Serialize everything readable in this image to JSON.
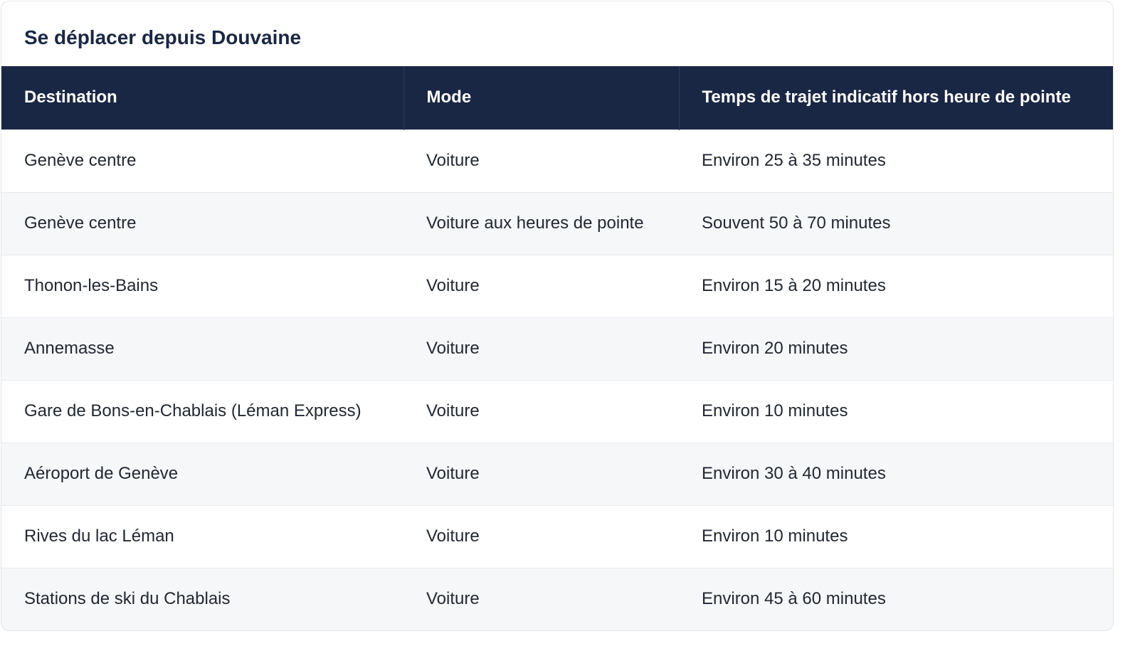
{
  "title": "Se déplacer depuis Douvaine",
  "table": {
    "headers": [
      "Destination",
      "Mode",
      "Temps de trajet indicatif hors heure de pointe"
    ],
    "rows": [
      [
        "Genève centre",
        "Voiture",
        "Environ 25 à 35 minutes"
      ],
      [
        "Genève centre",
        "Voiture aux heures de pointe",
        "Souvent 50 à 70 minutes"
      ],
      [
        "Thonon-les-Bains",
        "Voiture",
        "Environ 15 à 20 minutes"
      ],
      [
        "Annemasse",
        "Voiture",
        "Environ 20 minutes"
      ],
      [
        "Gare de Bons-en-Chablais (Léman Express)",
        "Voiture",
        "Environ 10 minutes"
      ],
      [
        "Aéroport de Genève",
        "Voiture",
        "Environ 30 à 40 minutes"
      ],
      [
        "Rives du lac Léman",
        "Voiture",
        "Environ 10 minutes"
      ],
      [
        "Stations de ski du Chablais",
        "Voiture",
        "Environ 45 à 60 minutes"
      ]
    ]
  }
}
